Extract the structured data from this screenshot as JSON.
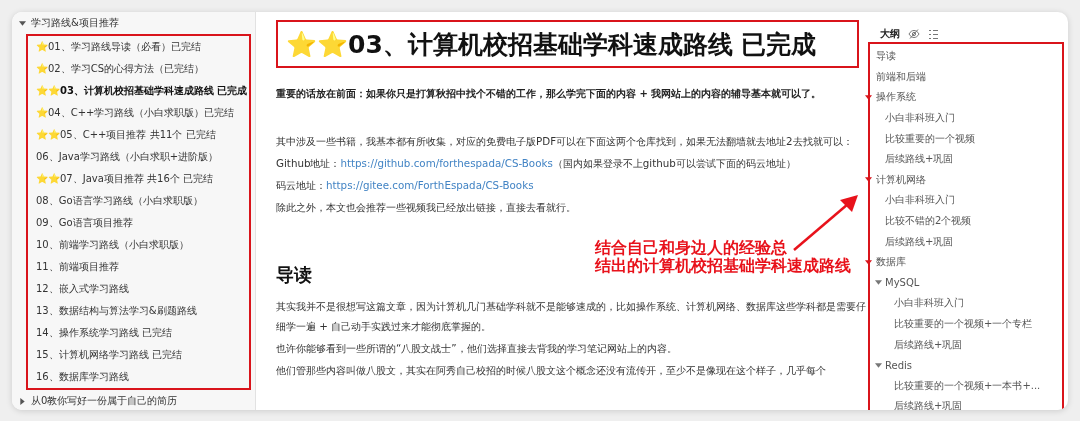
{
  "sidebar": {
    "items": [
      {
        "label": "学习路线&项目推荐",
        "expanded": true,
        "children": [
          {
            "label": "⭐01、学习路线导读（必看）已完结",
            "selected": false
          },
          {
            "label": "⭐02、学习CS的心得方法（已完结）",
            "selected": false
          },
          {
            "label": "⭐⭐03、计算机校招基础学科速成路线 已完成",
            "selected": true
          },
          {
            "label": "⭐04、C++学习路线（小白求职版）已完结",
            "selected": false
          },
          {
            "label": "⭐⭐05、C++项目推荐 共11个 已完结",
            "selected": false
          },
          {
            "label": "06、Java学习路线（小白求职+进阶版）",
            "selected": false
          },
          {
            "label": "⭐⭐07、Java项目推荐 共16个 已完结",
            "selected": false
          },
          {
            "label": "08、Go语言学习路线（小白求职版）",
            "selected": false
          },
          {
            "label": "09、Go语言项目推荐",
            "selected": false
          },
          {
            "label": "10、前端学习路线（小白求职版）",
            "selected": false
          },
          {
            "label": "11、前端项目推荐",
            "selected": false
          },
          {
            "label": "12、嵌入式学习路线",
            "selected": false
          },
          {
            "label": "13、数据结构与算法学习&刷题路线",
            "selected": false
          },
          {
            "label": "14、操作系统学习路线 已完结",
            "selected": false
          },
          {
            "label": "15、计算机网络学习路线 已完结",
            "selected": false
          },
          {
            "label": "16、数据库学习路线",
            "selected": false
          }
        ]
      },
      {
        "label": "从0教你写好一份属于自己的简历",
        "expanded": false
      }
    ]
  },
  "document": {
    "title": {
      "text": "⭐⭐03、计算机校招基础学科速成路线 已完成"
    },
    "blocks": [
      {
        "kind": "lead",
        "text": "重要的话放在前面：如果你只是打算秋招中找个不错的工作，那么学完下面的内容 + 我网站上的内容的辅导基本就可以了。"
      },
      {
        "kind": "paragraph",
        "text": "其中涉及一些书籍，我基本都有所收集，对应的免费电子版PDF可以在下面这两个仓库找到，如果无法翻墙就去地址2去找就可以："
      },
      {
        "kind": "link",
        "label": "Github地址：",
        "url": "https://github.com/forthespada/CS-Books",
        "note": "（国内如果登录不上github可以尝试下面的码云地址）"
      },
      {
        "kind": "link",
        "label": "码云地址：",
        "url": "https://gitee.com/ForthEspada/CS-Books"
      },
      {
        "kind": "paragraph",
        "text": "除此之外，本文也会推荐一些视频我已经放出链接，直接去看就行。"
      },
      {
        "kind": "heading",
        "text": "导读"
      },
      {
        "kind": "paragraph",
        "text": "其实我并不是很想写这篇文章，因为计算机几门基础学科就不是能够速成的，比如操作系统、计算机网络、数据库这些学科都是需要仔细学一遍 + 自己动手实践过来才能彻底掌握的。"
      },
      {
        "kind": "paragraph",
        "text": "也许你能够看到一些所谓的“八股文战士”，他们选择直接去背我的学习笔记网站上的内容。"
      },
      {
        "kind": "paragraph",
        "text": "他们管那些内容叫做八股文，其实在阿秀自己校招的时候八股文这个概念还没有流传开，至少不是像现在这个样子，几乎每个"
      }
    ]
  },
  "outline": {
    "title": "大纲",
    "items": [
      {
        "label": "导读"
      },
      {
        "label": "前端和后端"
      },
      {
        "label": "操作系统",
        "expanded": true,
        "children": [
          {
            "label": "小白非科班入门"
          },
          {
            "label": "比较重要的一个视频"
          },
          {
            "label": "后续路线+巩固"
          }
        ]
      },
      {
        "label": "计算机网络",
        "expanded": true,
        "children": [
          {
            "label": "小白非科班入门"
          },
          {
            "label": "比较不错的2个视频"
          },
          {
            "label": "后续路线+巩固"
          }
        ]
      },
      {
        "label": "数据库",
        "expanded": true,
        "children": [
          {
            "label": "MySQL",
            "expanded": true,
            "children": [
              {
                "label": "小白非科班入门"
              },
              {
                "label": "比较重要的一个视频+一个专栏"
              },
              {
                "label": "后续路线+巩固"
              }
            ]
          },
          {
            "label": "Redis",
            "expanded": true,
            "children": [
              {
                "label": "比较重要的一个视频+一本书+..."
              },
              {
                "label": "后续路线+巩固"
              }
            ]
          }
        ]
      }
    ]
  },
  "annotation": {
    "lines": [
      "结合自己和身边人的经验总",
      "结出的计算机校招基础学科速成路线"
    ]
  }
}
